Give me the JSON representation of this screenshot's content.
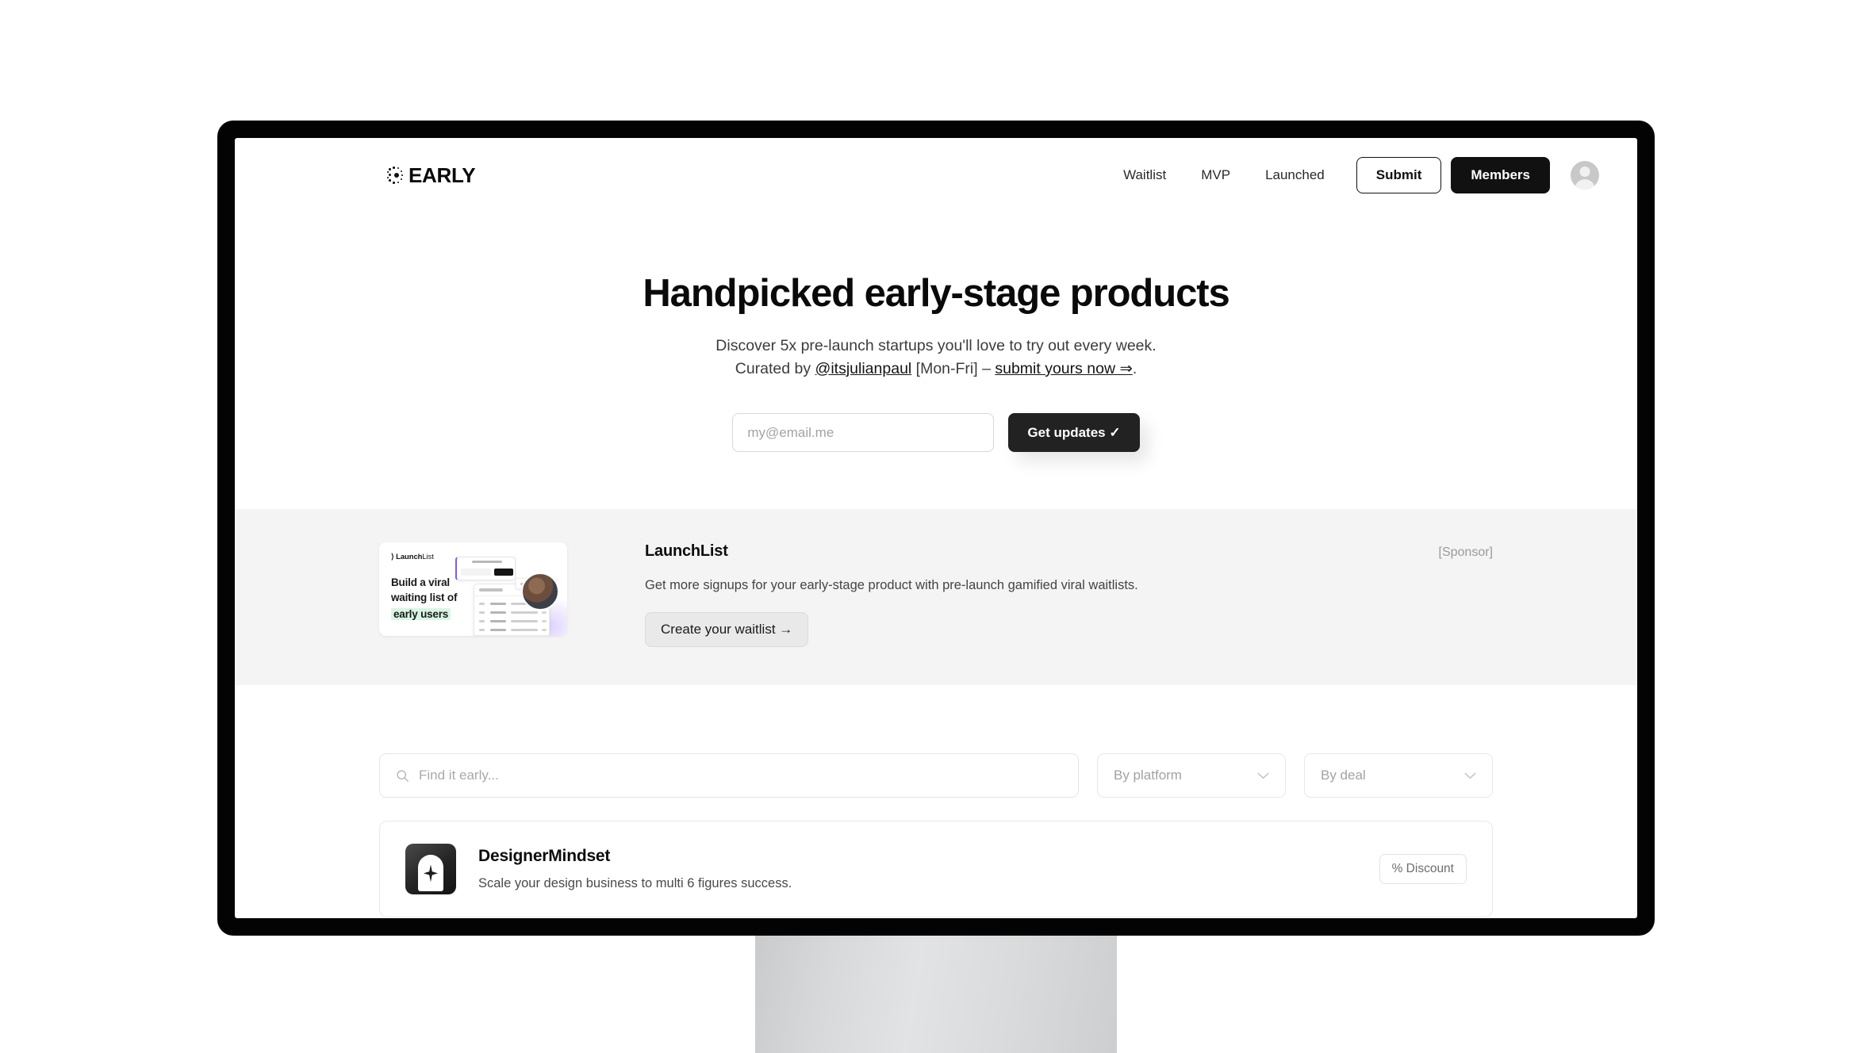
{
  "brand": {
    "name": "EARLY",
    "mark": "dotted-burst-icon"
  },
  "nav": {
    "links": [
      {
        "label": "Waitlist"
      },
      {
        "label": "MVP"
      },
      {
        "label": "Launched"
      }
    ],
    "submit_label": "Submit",
    "members_label": "Members",
    "avatar": "account-avatar"
  },
  "hero": {
    "title": "Handpicked early-stage products",
    "subtitle_line1": "Discover 5x pre-launch startups you'll love to try out every week.",
    "curated_prefix": "Curated by ",
    "curator_handle": "@itsjulianpaul",
    "curated_middle": " [Mon-Fri] – ",
    "submit_link": "submit yours now ⇒",
    "curated_suffix": ".",
    "email_placeholder": "my@email.me",
    "email_value": "",
    "cta_label": "Get updates ✓"
  },
  "sponsor": {
    "tag": "[Sponsor]",
    "title": "LaunchList",
    "description": "Get more signups for your early-stage product with pre-launch gamified viral waitlists.",
    "cta_label": "Create your waitlist →",
    "thumb": {
      "logo_bold": "Launch",
      "logo_light": "List",
      "headline_line1": "Build a viral",
      "headline_line2": "waiting list of",
      "headline_highlight": "early users"
    }
  },
  "filters": {
    "search_placeholder": "Find it early...",
    "search_value": "",
    "platform_label": "By platform",
    "deal_label": "By deal"
  },
  "products": [
    {
      "name": "DesignerMindset",
      "description": "Scale your design business to multi 6 figures success.",
      "badge": "% Discount",
      "logo": "head-sparkle-icon"
    }
  ],
  "colors": {
    "accent_dark": "#111111",
    "band_gray": "#f4f4f4",
    "bezel": "#030303"
  }
}
